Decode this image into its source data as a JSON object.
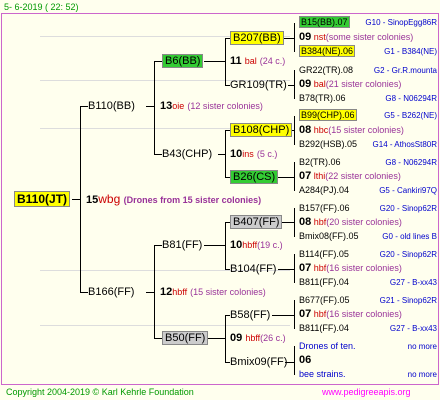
{
  "header": {
    "date": "5-  6-2019 ( 22: 52)"
  },
  "footer": {
    "copyright": "Copyright 2004-2019 © Karl Kehrle Foundation",
    "site": "www.pedigreeapis.org"
  },
  "root": {
    "label": "B110(JT)",
    "num": "15",
    "code": "wbg",
    "note": "(Drones from 15 sister colonies)"
  },
  "gen1": [
    {
      "label": "B110(BB)",
      "num": "13",
      "code": "oie",
      "note": "(12 sister colonies)"
    },
    {
      "label": "B166(FF)",
      "num": "12",
      "code": "hbff",
      "note": "(15 sister colonies)"
    }
  ],
  "gen2": [
    {
      "label": "B6(BB)",
      "num": "11",
      "code": "bal",
      "note": "(24 c.)"
    },
    {
      "label": "B43(CHP)",
      "num": "10",
      "code": "ins",
      "note": "(5 c.)"
    },
    {
      "label": "B81(FF)",
      "num": "10",
      "code": "hbff",
      "note": "(19 c.)"
    },
    {
      "label": "B50(FF)",
      "num": "09",
      "code": "hbff",
      "note": "(26 c.)"
    }
  ],
  "gen3": [
    {
      "label": "B207(BB)"
    },
    {
      "label": "GR109(TR)"
    },
    {
      "label": "B108(CHP)"
    },
    {
      "label": "B26(CS)"
    },
    {
      "label": "B407(FF)"
    },
    {
      "label": "B104(FF)"
    },
    {
      "label": "B58(FF)"
    },
    {
      "label": "Bmix09(FF)"
    }
  ],
  "gen4": [
    {
      "top": "B15(BB).07",
      "topr": "G10 - SinopEgg86R",
      "num": "09",
      "code": "nst",
      "note": "(some sister colonies)",
      "bottom": "B384(NE).06",
      "bottomr": "G1 - B384(NE)"
    },
    {
      "top": "GR22(TR).08",
      "topr": "G2 - Gr.R.mounta",
      "num": "09",
      "code": "bal",
      "note": "(21 sister colonies)",
      "bottom": "B78(TR).06",
      "bottomr": "G8 - N06294R"
    },
    {
      "top": "B99(CHP).06",
      "topr": "G5 - B262(NE)",
      "num": "08",
      "code": "hbc",
      "note": "(15 sister colonies)",
      "bottom": "B292(HSB).05",
      "bottomr": "G14 - AthosSt80R"
    },
    {
      "top": "B2(TR).06",
      "topr": "G8 - N06294R",
      "num": "07",
      "code": "lthi",
      "note": "(22 sister colonies)",
      "bottom": "A284(PJ).04",
      "bottomr": "G5 - Cankiri97Q"
    },
    {
      "top": "B157(FF).06",
      "topr": "G20 - Sinop62R",
      "num": "08",
      "code": "hbf",
      "note": "(20 sister colonies)",
      "bottom": "Bmix08(FF).05",
      "bottomr": "G0 - old lines B"
    },
    {
      "top": "B114(FF).05",
      "topr": "G20 - Sinop62R",
      "num": "07",
      "code": "hbf",
      "note": "(16 sister colonies)",
      "bottom": "B811(FF).04",
      "bottomr": "G27 - B-xx43"
    },
    {
      "top": "B677(FF).05",
      "topr": "G21 - Sinop62R",
      "num": "07",
      "code": "hbf",
      "note": "(16 sister colonies)",
      "bottom": "B811(FF).04",
      "bottomr": "G27 - B-xx43"
    },
    {
      "top": "Drones of ten.",
      "topr": "no more",
      "num": "06",
      "code": "",
      "note": "",
      "bottom": "bee strains.",
      "bottomr": "no more"
    }
  ],
  "colors": {
    "yellow": "#ffff00",
    "green": "#33cc33",
    "gray": "#cccccc",
    "red": "#cc0000",
    "blue": "#0000cc"
  }
}
